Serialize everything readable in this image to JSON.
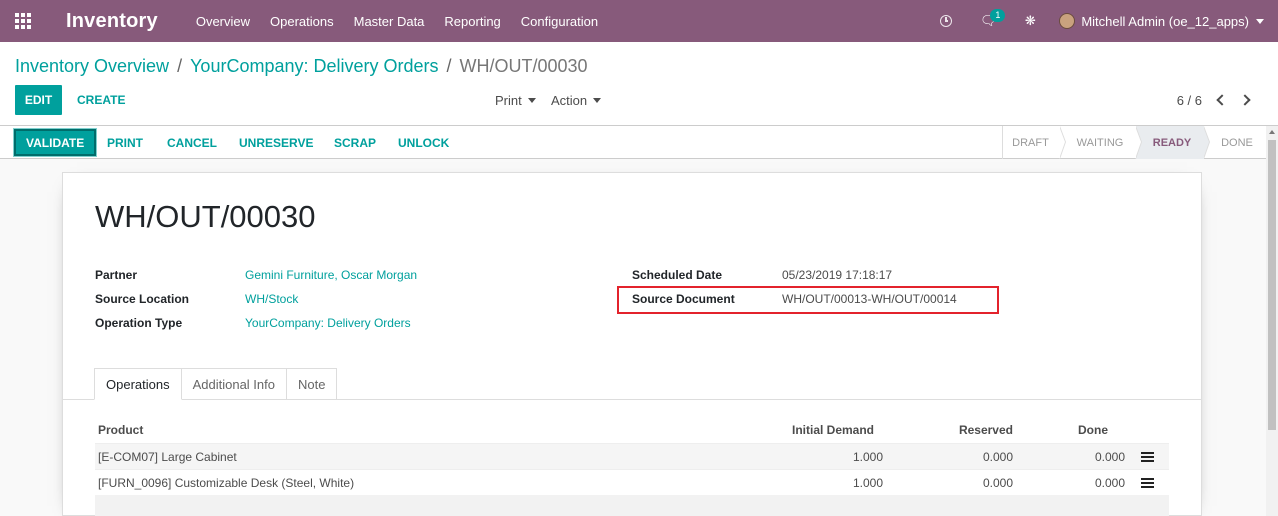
{
  "navbar": {
    "app_name": "Inventory",
    "menu": [
      "Overview",
      "Operations",
      "Master Data",
      "Reporting",
      "Configuration"
    ],
    "chat_badge": "1",
    "user": "Mitchell Admin (oe_12_apps)"
  },
  "breadcrumb": {
    "items": [
      "Inventory Overview",
      "YourCompany: Delivery Orders"
    ],
    "current": "WH/OUT/00030"
  },
  "actions": {
    "edit": "EDIT",
    "create": "CREATE",
    "print": "Print",
    "action": "Action"
  },
  "pager": {
    "value": "6 / 6"
  },
  "header_buttons": {
    "validate": "VALIDATE",
    "print": "PRINT",
    "cancel": "CANCEL",
    "unreserve": "UNRESERVE",
    "scrap": "SCRAP",
    "unlock": "UNLOCK"
  },
  "stages": [
    "DRAFT",
    "WAITING",
    "READY",
    "DONE"
  ],
  "active_stage": "READY",
  "record": {
    "title": "WH/OUT/00030",
    "partner_label": "Partner",
    "partner": "Gemini Furniture, Oscar Morgan",
    "source_location_label": "Source Location",
    "source_location": "WH/Stock",
    "operation_type_label": "Operation Type",
    "operation_type": "YourCompany: Delivery Orders",
    "scheduled_date_label": "Scheduled Date",
    "scheduled_date": "05/23/2019 17:18:17",
    "source_document_label": "Source Document",
    "source_document": "WH/OUT/00013-WH/OUT/00014"
  },
  "tabs": [
    "Operations",
    "Additional Info",
    "Note"
  ],
  "table": {
    "columns": [
      "Product",
      "Initial Demand",
      "Reserved",
      "Done"
    ],
    "rows": [
      [
        "[E-COM07] Large Cabinet",
        "1.000",
        "0.000",
        "0.000"
      ],
      [
        "[FURN_0096] Customizable Desk (Steel, White)",
        "1.000",
        "0.000",
        "0.000"
      ]
    ]
  },
  "colors": {
    "brand": "#875a7b",
    "accent": "#00a09d",
    "highlight_box": "#e3232c"
  },
  "icons": [
    "apps-grid-icon",
    "clock-icon",
    "chat-icon",
    "bug-icon",
    "chevron-left-icon",
    "chevron-right-icon",
    "list-detail-icon"
  ]
}
